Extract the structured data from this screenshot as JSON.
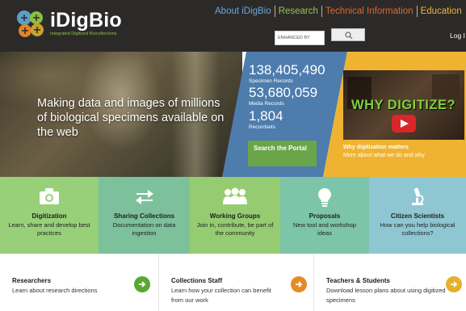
{
  "colors": {
    "header_bg": "#2c2a29",
    "stats_blue": "#4d7cad",
    "video_gold": "#f0b331",
    "portal_green": "#6aa54a",
    "arrow_green": "#5aa832",
    "arrow_orange": "#e58b25",
    "arrow_yellow": "#e6b02a"
  },
  "header": {
    "logo_text": "iDigBio",
    "logo_subtitle": "Integrated Digitized Biocollections",
    "nav": [
      "About iDigBio",
      "Research",
      "Technical Information",
      "Education"
    ],
    "search_placeholder": "ENHANCED BY",
    "search_icon": "search-icon",
    "login": "Log I"
  },
  "hero": {
    "tagline": "Making data and images of millions of biological specimens available on the web",
    "stats": [
      {
        "value": "138,405,490",
        "label": "Specimen Records"
      },
      {
        "value": "53,680,059",
        "label": "Media Records"
      },
      {
        "value": "1,804",
        "label": "Recordsets"
      }
    ],
    "portal_button": "Search the Portal",
    "video": {
      "title": "WHY DIGITIZE?",
      "caption_title": "Why digitization matters",
      "caption_desc": "More about what we do and why",
      "icon": "play-icon"
    }
  },
  "tiles": [
    {
      "title": "Digitization",
      "desc": "Learn, share and develop best practices",
      "icon": "camera-icon"
    },
    {
      "title": "Sharing Collections",
      "desc": "Documentation on data ingestion",
      "icon": "exchange-arrows-icon"
    },
    {
      "title": "Working Groups",
      "desc": "Join in, contribute, be part of the community",
      "icon": "people-icon"
    },
    {
      "title": "Proposals",
      "desc": "New tool and workshop ideas",
      "icon": "lightbulb-icon"
    },
    {
      "title": "Citizen Scientists",
      "desc": "How can you help biological collections?",
      "icon": "microscope-icon"
    }
  ],
  "audiences": [
    {
      "title": "Researchers",
      "desc": "Learn about research directions",
      "icon": "arrow-right-icon"
    },
    {
      "title": "Collections Staff",
      "desc": "Learn how your collection can benefit from our work",
      "icon": "arrow-right-icon"
    },
    {
      "title": "Teachers & Students",
      "desc": "Download lesson plans about using digitized specimens",
      "icon": "arrow-right-icon"
    }
  ]
}
